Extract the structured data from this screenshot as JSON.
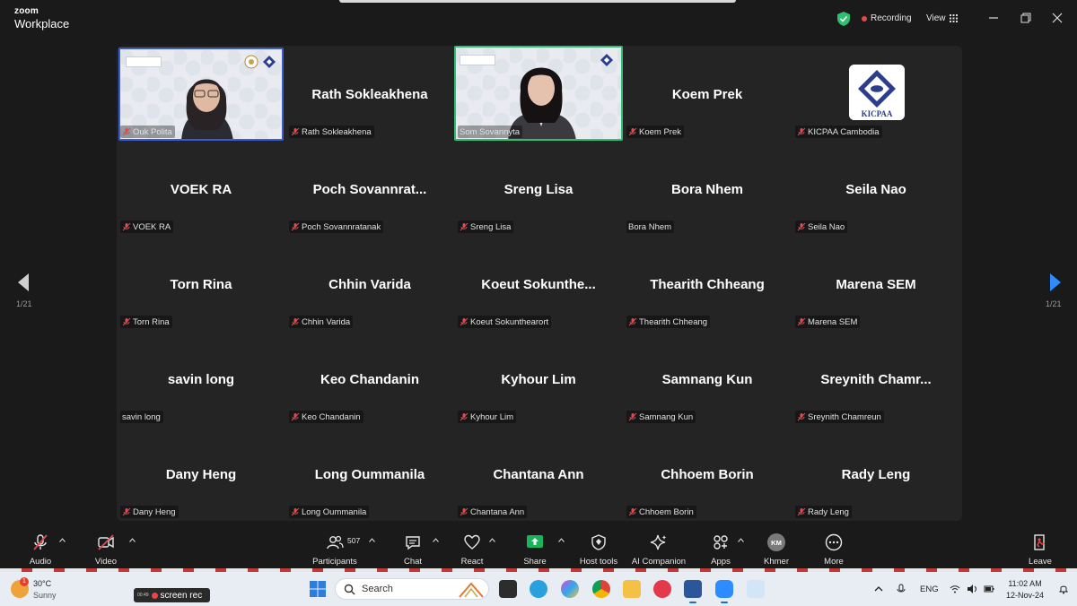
{
  "titlebar": {
    "brand_top": "zoom",
    "brand_bottom": "Workplace",
    "recording_label": "Recording",
    "view_label": "View"
  },
  "gallery": {
    "page_indicator": "1/21",
    "tiles": [
      {
        "big": "",
        "name": "Ouk Polita",
        "muted": true,
        "video": true,
        "speaker": true
      },
      {
        "big": "Rath Sokleakhena",
        "name": "Rath Sokleakhena",
        "muted": true
      },
      {
        "big": "",
        "name": "Som Sovannyta",
        "muted": false,
        "video": true,
        "active": true
      },
      {
        "big": "Koem Prek",
        "name": "Koem Prek",
        "muted": true
      },
      {
        "big": "",
        "name": "KICPAA Cambodia",
        "muted": true,
        "logo": "KICPAA"
      },
      {
        "big": "VOEK RA",
        "name": "VOEK RA",
        "muted": true
      },
      {
        "big": "Poch  Sovannrat...",
        "name": "Poch Sovannratanak",
        "muted": true
      },
      {
        "big": "Sreng Lisa",
        "name": "Sreng Lisa",
        "muted": true
      },
      {
        "big": "Bora Nhem",
        "name": "Bora Nhem",
        "muted": false
      },
      {
        "big": "Seila Nao",
        "name": "Seila Nao",
        "muted": true
      },
      {
        "big": "Torn Rina",
        "name": "Torn Rina",
        "muted": true
      },
      {
        "big": "Chhin Varida",
        "name": "Chhin Varida",
        "muted": true
      },
      {
        "big": "Koeut  Sokunthe...",
        "name": "Koeut Sokunthearort",
        "muted": true
      },
      {
        "big": "Thearith Chheang",
        "name": "Thearith Chheang",
        "muted": true
      },
      {
        "big": "Marena SEM",
        "name": "Marena SEM",
        "muted": true
      },
      {
        "big": "savin long",
        "name": "savin long",
        "muted": false
      },
      {
        "big": "Keo Chandanin",
        "name": "Keo Chandanin",
        "muted": true
      },
      {
        "big": "Kyhour Lim",
        "name": "Kyhour Lim",
        "muted": true
      },
      {
        "big": "Samnang Kun",
        "name": "Samnang Kun",
        "muted": true
      },
      {
        "big": "Sreynith  Chamr...",
        "name": "Sreynith Chamreun",
        "muted": true
      },
      {
        "big": "Dany Heng",
        "name": "Dany Heng",
        "muted": true
      },
      {
        "big": "Long Oummanila",
        "name": "Long Oummanila",
        "muted": true
      },
      {
        "big": "Chantana Ann",
        "name": "Chantana Ann",
        "muted": true
      },
      {
        "big": "Chhoem Borin",
        "name": "Chhoem Borin",
        "muted": true
      },
      {
        "big": "Rady Leng",
        "name": "Rady Leng",
        "muted": true
      }
    ]
  },
  "toolbar": {
    "audio": "Audio",
    "video": "Video",
    "participants": "Participants",
    "participant_count": "507",
    "chat": "Chat",
    "react": "React",
    "share": "Share",
    "host_tools": "Host tools",
    "ai_companion": "AI Companion",
    "apps": "Apps",
    "khmer": "Khmer",
    "khmer_initials": "KM",
    "more": "More",
    "leave": "Leave"
  },
  "taskbar": {
    "weather_temp": "30°C",
    "weather_cond": "Sunny",
    "weather_badge": "1",
    "screenrec_time": "00:49",
    "screenrec_label": "screen rec",
    "search_placeholder": "Search",
    "lang": "ENG",
    "time": "11:02 AM",
    "date": "12-Nov-24"
  },
  "colors": {
    "accent_green": "#2fbf71",
    "share_green": "#19b45a",
    "recording_red": "#e5484d",
    "muted_red": "#e5484d",
    "arrow_blue": "#2d8cff"
  }
}
